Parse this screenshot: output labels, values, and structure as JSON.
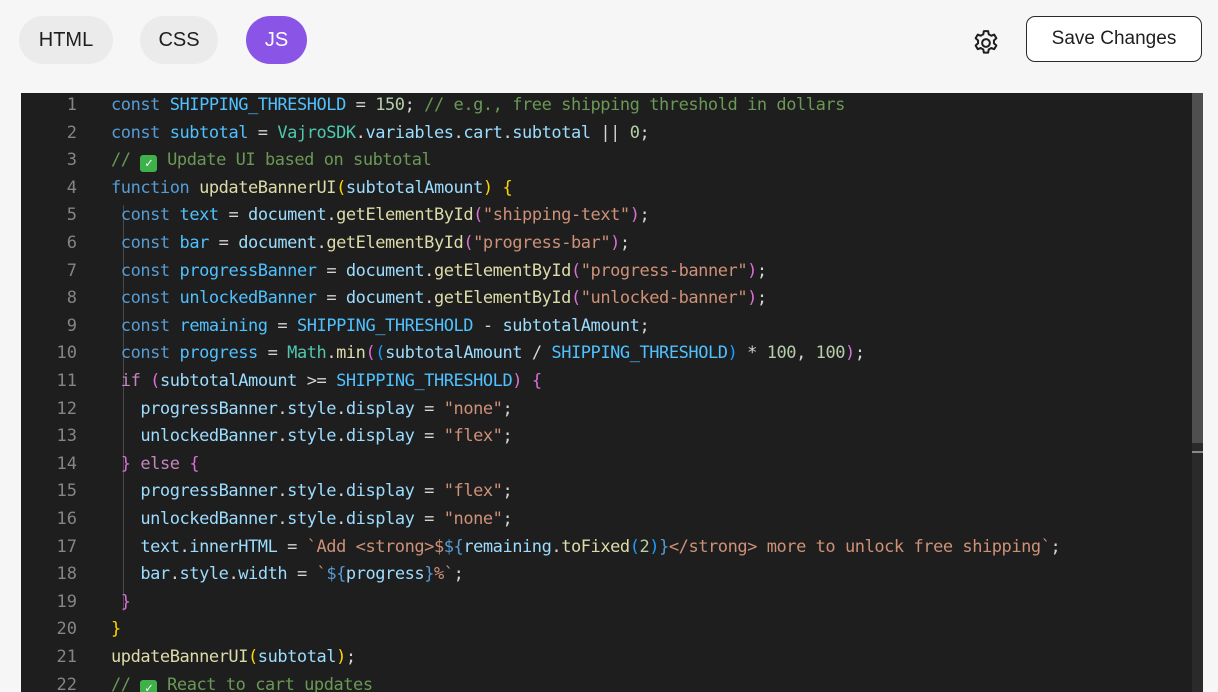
{
  "tabs": [
    {
      "label": "HTML",
      "active": false
    },
    {
      "label": "CSS",
      "active": false
    },
    {
      "label": "JS",
      "active": true
    }
  ],
  "settings_icon": "gear-icon",
  "save_button": {
    "label": "Save Changes"
  },
  "colors": {
    "accent": "#8a55e6",
    "editor_background": "#1e1e1e",
    "page_background": "#f6f6f7"
  },
  "editor": {
    "language": "JavaScript",
    "lines": [
      {
        "n": "1",
        "tokens": [
          [
            "k",
            "const"
          ],
          [
            "",
            "",
            " "
          ],
          [
            "cn",
            "SHIPPING_THRESHOLD"
          ],
          [
            "",
            "",
            " = "
          ],
          [
            "n",
            "150"
          ],
          [
            "",
            ";"
          ],
          [
            "c",
            " // e.g., free shipping threshold in dollars"
          ]
        ]
      },
      {
        "n": "2",
        "tokens": [
          [
            "k",
            "const"
          ],
          [
            "",
            " "
          ],
          [
            "cn",
            "subtotal"
          ],
          [
            "",
            " = "
          ],
          [
            "t",
            "VajroSDK"
          ],
          [
            "",
            "."
          ],
          [
            "v",
            "variables"
          ],
          [
            "",
            "."
          ],
          [
            "v",
            "cart"
          ],
          [
            "",
            "."
          ],
          [
            "v",
            "subtotal"
          ],
          [
            "",
            " || "
          ],
          [
            "n",
            "0"
          ],
          [
            "",
            ";"
          ]
        ]
      },
      {
        "n": "3",
        "tokens": [
          [
            "c",
            "// "
          ],
          [
            "check",
            "✓"
          ],
          [
            "c",
            " Update UI based on subtotal"
          ]
        ]
      },
      {
        "n": "4",
        "tokens": [
          [
            "k",
            "function"
          ],
          [
            "",
            " "
          ],
          [
            "f",
            "updateBannerUI"
          ],
          [
            "y",
            "("
          ],
          [
            "v",
            "subtotalAmount"
          ],
          [
            "y",
            ")"
          ],
          [
            "",
            " "
          ],
          [
            "y",
            "{"
          ]
        ]
      },
      {
        "n": "5",
        "tokens": [
          [
            "",
            " "
          ],
          [
            "k",
            "const"
          ],
          [
            "",
            " "
          ],
          [
            "cn",
            "text"
          ],
          [
            "",
            " = "
          ],
          [
            "v",
            "document"
          ],
          [
            "",
            "."
          ],
          [
            "f",
            "getElementById"
          ],
          [
            "pl",
            "("
          ],
          [
            "s",
            "\"shipping-text\""
          ],
          [
            "pl",
            ")"
          ],
          [
            "",
            ";"
          ]
        ]
      },
      {
        "n": "6",
        "tokens": [
          [
            "",
            " "
          ],
          [
            "k",
            "const"
          ],
          [
            "",
            " "
          ],
          [
            "cn",
            "bar"
          ],
          [
            "",
            " = "
          ],
          [
            "v",
            "document"
          ],
          [
            "",
            "."
          ],
          [
            "f",
            "getElementById"
          ],
          [
            "pl",
            "("
          ],
          [
            "s",
            "\"progress-bar\""
          ],
          [
            "pl",
            ")"
          ],
          [
            "",
            ";"
          ]
        ]
      },
      {
        "n": "7",
        "tokens": [
          [
            "",
            " "
          ],
          [
            "k",
            "const"
          ],
          [
            "",
            " "
          ],
          [
            "cn",
            "progressBanner"
          ],
          [
            "",
            " = "
          ],
          [
            "v",
            "document"
          ],
          [
            "",
            "."
          ],
          [
            "f",
            "getElementById"
          ],
          [
            "pl",
            "("
          ],
          [
            "s",
            "\"progress-banner\""
          ],
          [
            "pl",
            ")"
          ],
          [
            "",
            ";"
          ]
        ]
      },
      {
        "n": "8",
        "tokens": [
          [
            "",
            " "
          ],
          [
            "k",
            "const"
          ],
          [
            "",
            " "
          ],
          [
            "cn",
            "unlockedBanner"
          ],
          [
            "",
            " = "
          ],
          [
            "v",
            "document"
          ],
          [
            "",
            "."
          ],
          [
            "f",
            "getElementById"
          ],
          [
            "pl",
            "("
          ],
          [
            "s",
            "\"unlocked-banner\""
          ],
          [
            "pl",
            ")"
          ],
          [
            "",
            ";"
          ]
        ]
      },
      {
        "n": "9",
        "tokens": [
          [
            "",
            " "
          ],
          [
            "k",
            "const"
          ],
          [
            "",
            " "
          ],
          [
            "cn",
            "remaining"
          ],
          [
            "",
            " = "
          ],
          [
            "cn",
            "SHIPPING_THRESHOLD"
          ],
          [
            "",
            " - "
          ],
          [
            "v",
            "subtotalAmount"
          ],
          [
            "",
            ";"
          ]
        ]
      },
      {
        "n": "10",
        "tokens": [
          [
            "",
            " "
          ],
          [
            "k",
            "const"
          ],
          [
            "",
            " "
          ],
          [
            "cn",
            "progress"
          ],
          [
            "",
            " = "
          ],
          [
            "t",
            "Math"
          ],
          [
            "",
            "."
          ],
          [
            "f",
            "min"
          ],
          [
            "pl",
            "("
          ],
          [
            "b",
            "("
          ],
          [
            "v",
            "subtotalAmount"
          ],
          [
            "",
            " / "
          ],
          [
            "cn",
            "SHIPPING_THRESHOLD"
          ],
          [
            "b",
            ")"
          ],
          [
            "",
            " * "
          ],
          [
            "n",
            "100"
          ],
          [
            "",
            ", "
          ],
          [
            "n",
            "100"
          ],
          [
            "pl",
            ")"
          ],
          [
            "",
            ";"
          ]
        ]
      },
      {
        "n": "11",
        "tokens": [
          [
            "",
            " "
          ],
          [
            "p",
            "if"
          ],
          [
            "",
            " "
          ],
          [
            "pl",
            "("
          ],
          [
            "v",
            "subtotalAmount"
          ],
          [
            "",
            " >= "
          ],
          [
            "cn",
            "SHIPPING_THRESHOLD"
          ],
          [
            "pl",
            ")"
          ],
          [
            "",
            " "
          ],
          [
            "pl",
            "{"
          ]
        ]
      },
      {
        "n": "12",
        "tokens": [
          [
            "",
            "   "
          ],
          [
            "v",
            "progressBanner"
          ],
          [
            "",
            "."
          ],
          [
            "v",
            "style"
          ],
          [
            "",
            "."
          ],
          [
            "v",
            "display"
          ],
          [
            "",
            " = "
          ],
          [
            "s",
            "\"none\""
          ],
          [
            "",
            ";"
          ]
        ]
      },
      {
        "n": "13",
        "tokens": [
          [
            "",
            "   "
          ],
          [
            "v",
            "unlockedBanner"
          ],
          [
            "",
            "."
          ],
          [
            "v",
            "style"
          ],
          [
            "",
            "."
          ],
          [
            "v",
            "display"
          ],
          [
            "",
            " = "
          ],
          [
            "s",
            "\"flex\""
          ],
          [
            "",
            ";"
          ]
        ]
      },
      {
        "n": "14",
        "tokens": [
          [
            "",
            " "
          ],
          [
            "pl",
            "}"
          ],
          [
            "",
            " "
          ],
          [
            "p",
            "else"
          ],
          [
            "",
            " "
          ],
          [
            "pl",
            "{"
          ]
        ]
      },
      {
        "n": "15",
        "tokens": [
          [
            "",
            "   "
          ],
          [
            "v",
            "progressBanner"
          ],
          [
            "",
            "."
          ],
          [
            "v",
            "style"
          ],
          [
            "",
            "."
          ],
          [
            "v",
            "display"
          ],
          [
            "",
            " = "
          ],
          [
            "s",
            "\"flex\""
          ],
          [
            "",
            ";"
          ]
        ]
      },
      {
        "n": "16",
        "tokens": [
          [
            "",
            "   "
          ],
          [
            "v",
            "unlockedBanner"
          ],
          [
            "",
            "."
          ],
          [
            "v",
            "style"
          ],
          [
            "",
            "."
          ],
          [
            "v",
            "display"
          ],
          [
            "",
            " = "
          ],
          [
            "s",
            "\"none\""
          ],
          [
            "",
            ";"
          ]
        ]
      },
      {
        "n": "17",
        "tokens": [
          [
            "",
            "   "
          ],
          [
            "v",
            "text"
          ],
          [
            "",
            "."
          ],
          [
            "v",
            "innerHTML"
          ],
          [
            "",
            " = "
          ],
          [
            "s",
            "`Add <strong>$"
          ],
          [
            "k",
            "${"
          ],
          [
            "v",
            "remaining"
          ],
          [
            "",
            "."
          ],
          [
            "f",
            "toFixed"
          ],
          [
            "b",
            "("
          ],
          [
            "n",
            "2"
          ],
          [
            "b",
            ")"
          ],
          [
            "k",
            "}"
          ],
          [
            "s",
            "</strong> more to unlock free shipping`"
          ],
          [
            "",
            ";"
          ]
        ]
      },
      {
        "n": "18",
        "tokens": [
          [
            "",
            "   "
          ],
          [
            "v",
            "bar"
          ],
          [
            "",
            "."
          ],
          [
            "v",
            "style"
          ],
          [
            "",
            "."
          ],
          [
            "v",
            "width"
          ],
          [
            "",
            " = "
          ],
          [
            "s",
            "`"
          ],
          [
            "k",
            "${"
          ],
          [
            "v",
            "progress"
          ],
          [
            "k",
            "}"
          ],
          [
            "s",
            "%`"
          ],
          [
            "",
            ";"
          ]
        ]
      },
      {
        "n": "19",
        "tokens": [
          [
            "",
            " "
          ],
          [
            "pl",
            "}"
          ]
        ]
      },
      {
        "n": "20",
        "tokens": [
          [
            "y",
            "}"
          ]
        ]
      },
      {
        "n": "21",
        "tokens": [
          [
            "f",
            "updateBannerUI"
          ],
          [
            "y",
            "("
          ],
          [
            "v",
            "subtotal"
          ],
          [
            "y",
            ")"
          ],
          [
            "",
            ";"
          ]
        ]
      },
      {
        "n": "22",
        "tokens": [
          [
            "c",
            "// "
          ],
          [
            "check",
            "✓"
          ],
          [
            "c",
            " React to cart updates"
          ]
        ]
      }
    ]
  }
}
